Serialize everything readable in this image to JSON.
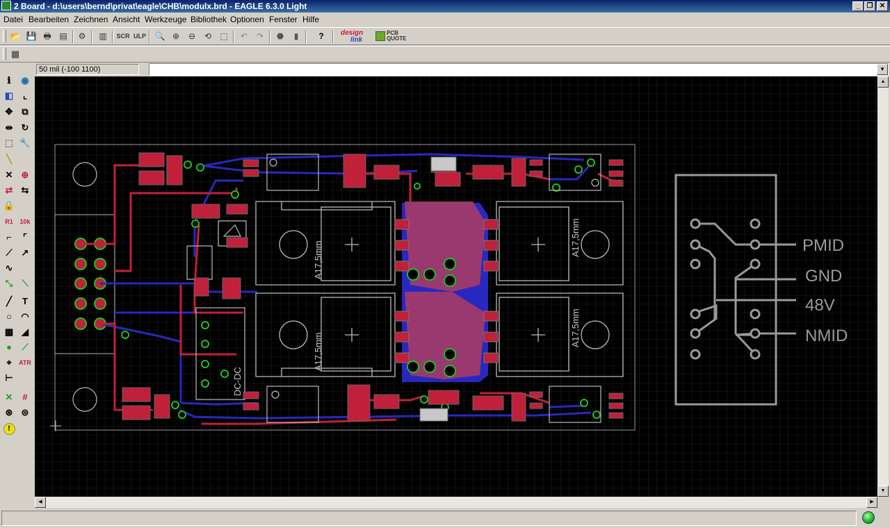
{
  "window": {
    "title": "2 Board - d:\\users\\bernd\\privat\\eagle\\CHB\\modulx.brd - EAGLE 6.3.0 Light",
    "minimize_glyph": "_",
    "restore_glyph": "❐",
    "close_glyph": "✕"
  },
  "menu": [
    "Datei",
    "Bearbeiten",
    "Zeichnen",
    "Ansicht",
    "Werkzeuge",
    "Bibliothek",
    "Optionen",
    "Fenster",
    "Hilfe"
  ],
  "toolbar": {
    "icons": [
      "open-icon",
      "save-icon",
      "print-icon",
      "cam-processor-icon",
      "script-icon",
      "library-icon",
      "script-file-icon",
      "ulp-icon",
      "zoom-fit-icon",
      "zoom-in-icon",
      "zoom-out-icon",
      "zoom-redraw-icon",
      "zoom-select-icon",
      "undo-icon",
      "redo-icon",
      "stop-icon",
      "go-icon",
      "help-icon"
    ],
    "designlink_text": [
      "design",
      "link"
    ],
    "pcbquote_text": [
      "PCB",
      "QUOTE"
    ],
    "grid_icon": "grid-icon"
  },
  "coordinates": {
    "readout": "50 mil (-100 1100)"
  },
  "command_line": {
    "value": ""
  },
  "palette": {
    "icons": [
      "info-icon",
      "show-icon",
      "display-layers-icon",
      "mark-icon",
      "move-icon",
      "copy-icon",
      "mirror-icon",
      "rotate-icon",
      "group-icon",
      "change-icon",
      "wire-cut-icon",
      "paste-icon",
      "delete-icon",
      "add-icon",
      "pinswap-icon",
      "replace-icon",
      "lock-icon",
      "smash-icon",
      "name-icon",
      "value-icon",
      "split-icon",
      "miter-icon",
      "optimize-icon",
      "route-icon",
      "ripup-icon",
      "meander-icon",
      "line-icon",
      "text-icon",
      "circle-icon",
      "arc-icon",
      "rect-icon",
      "polygon-icon",
      "via-icon",
      "signal-icon",
      "hole-icon",
      "attribute-icon",
      "dimension-icon",
      "ratsnest-icon",
      "autorouter-icon",
      "drc-icon",
      "errors-icon",
      "error-check-icon"
    ]
  },
  "board": {
    "labels": [
      "A17,5mm",
      "A17,5mm",
      "A17,5mm",
      "A17,5mm",
      "DC-DC"
    ],
    "connector_labels": [
      "PMID",
      "GND",
      "48V",
      "NMID"
    ]
  },
  "status": {
    "message": ""
  },
  "colors": {
    "titlebar": "#0a246a",
    "board_background": "#000000",
    "top_copper": "#c0203a",
    "bottom_copper": "#2828c0",
    "vias": "#22c022",
    "outline": "#9a9a9a",
    "status_led": "#12b12a"
  }
}
